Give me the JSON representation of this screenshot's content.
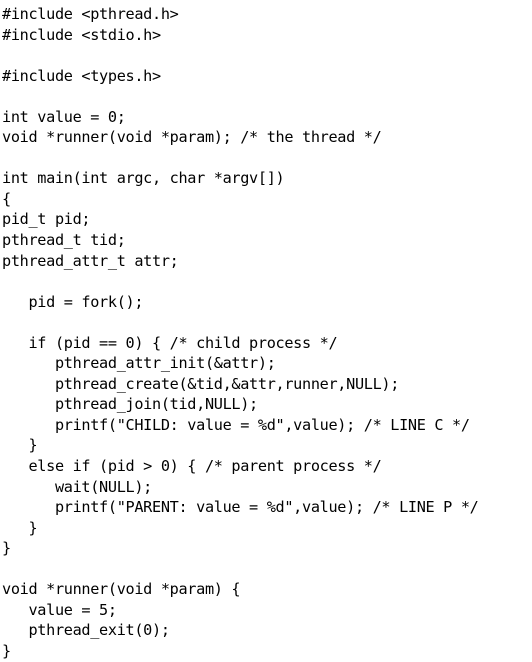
{
  "document": {
    "kind": "source-code-listing",
    "language": "C",
    "background_color": "#ffffff",
    "text_color": "#010101",
    "line_count": 31
  },
  "code": {
    "lines": [
      "#include <pthread.h>",
      "#include <stdio.h>",
      "",
      "#include <types.h>",
      "",
      "int value = 0;",
      "void *runner(void *param); /* the thread */",
      "",
      "int main(int argc, char *argv[])",
      "{",
      "pid_t pid;",
      "pthread_t tid;",
      "pthread_attr_t attr;",
      "",
      "   pid = fork();",
      "",
      "   if (pid == 0) { /* child process */",
      "      pthread_attr_init(&attr);",
      "      pthread_create(&tid,&attr,runner,NULL);",
      "      pthread_join(tid,NULL);",
      "      printf(\"CHILD: value = %d\",value); /* LINE C */",
      "   }",
      "   else if (pid > 0) { /* parent process */",
      "      wait(NULL);",
      "      printf(\"PARENT: value = %d\",value); /* LINE P */",
      "   }",
      "}",
      "",
      "void *runner(void *param) {",
      "   value = 5;",
      "   pthread_exit(0);",
      "}"
    ]
  }
}
